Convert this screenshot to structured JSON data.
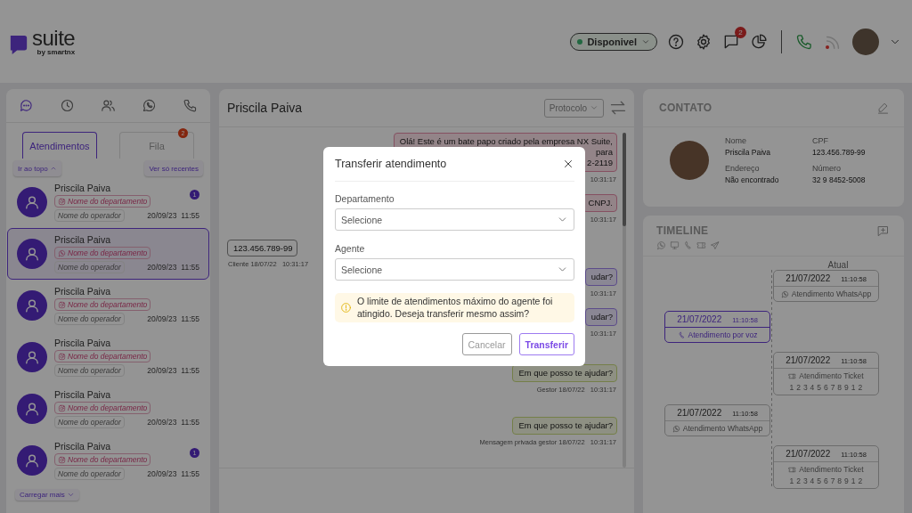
{
  "header": {
    "brand": "suite",
    "brand_sub": "by smartnx",
    "status": {
      "label": "Disponivel"
    },
    "notification_count": "2"
  },
  "left_panel": {
    "channel_tabs": [
      {
        "kind": "chat",
        "selected": true
      },
      {
        "kind": "history",
        "selected": false
      },
      {
        "kind": "contacts",
        "selected": false
      },
      {
        "kind": "whatsapp",
        "selected": false
      },
      {
        "kind": "phone",
        "selected": false
      }
    ],
    "list_tabs": [
      {
        "label": "Atendimentos",
        "selected": true
      },
      {
        "label": "Fila",
        "selected": false,
        "badge": "2"
      }
    ],
    "scroll_top": "Ir ao topo",
    "recent_only": "Ver só recentes",
    "conversations": [
      {
        "name": "Priscila Paiva",
        "kind": "instagram",
        "department": "Nome do departamento",
        "operator": "Nome do operador",
        "date": "20/09/23",
        "time": "11:55",
        "unread": "1",
        "selected": false
      },
      {
        "name": "Priscila Paiva",
        "kind": "whatsapp",
        "department": "Nome do departamento",
        "operator": "Nome do operador",
        "date": "20/09/23",
        "time": "11:55",
        "selected": true
      },
      {
        "name": "Priscila Paiva",
        "kind": "instagram",
        "department": "Nome do departamento",
        "operator": "Nome do operador",
        "date": "20/09/23",
        "time": "11:55",
        "selected": false
      },
      {
        "name": "Priscila Paiva",
        "kind": "instagram",
        "department": "Nome do departamento",
        "operator": "Nome do operador",
        "date": "20/09/23",
        "time": "11:55",
        "selected": false
      },
      {
        "name": "Priscila Paiva",
        "kind": "instagram",
        "department": "Nome do departamento",
        "operator": "Nome do operador",
        "date": "20/09/23",
        "time": "11:55",
        "selected": false
      },
      {
        "name": "Priscila Paiva",
        "kind": "instagram",
        "department": "Nome do departamento",
        "operator": "Nome do operador",
        "date": "20/09/23",
        "time": "11:55",
        "unread": "1",
        "selected": false
      }
    ],
    "load_more": "Carregar mais"
  },
  "chat": {
    "title": "Priscila Paiva",
    "protocol_label": "Protocolo",
    "messages": [
      {
        "kind": "bot",
        "lines": [
          "Olá! Este é um bate papo criado pela empresa NX Suite,",
          "para",
          "2-2119"
        ],
        "meta": "10:31:17"
      },
      {
        "kind": "bot",
        "lines": [
          "CNPJ."
        ],
        "meta": "10:31:17"
      },
      {
        "kind": "client",
        "lines": [
          "123.456.789-99"
        ],
        "meta": "Cliente 18/07/22   10:31:17"
      },
      {
        "kind": "agent",
        "lines": [
          "udar?"
        ],
        "meta": "10:31:17"
      },
      {
        "kind": "agent",
        "lines": [
          "udar?"
        ],
        "meta": "10:31:17"
      },
      {
        "kind": "manager",
        "lines": [
          "Em que posso te ajudar?"
        ],
        "meta": "Gestor 18/07/22   10:31:17"
      },
      {
        "kind": "manager",
        "lines": [
          "Em que posso te ajudar?"
        ],
        "meta": "Mensagem privada gestor 18/07/22   10:31:17"
      }
    ]
  },
  "contact": {
    "title": "CONTATO",
    "fields": [
      {
        "label": "Nome",
        "value": "Priscila Paiva"
      },
      {
        "label": "CPF",
        "value": "123.456.789-99"
      },
      {
        "label": "Endereço",
        "value": "Não encontrado"
      },
      {
        "label": "Número",
        "value": "32 9 8452-5008"
      }
    ]
  },
  "timeline": {
    "title": "TIMELINE",
    "filters": [
      {
        "kind": "whatsapp"
      },
      {
        "kind": "monitor"
      },
      {
        "kind": "voice"
      },
      {
        "kind": "ticket"
      },
      {
        "kind": "telegram"
      }
    ],
    "current_label": "Atual",
    "events": [
      {
        "right": {
          "date": "21/07/2022",
          "time": "11:10:58",
          "kind": "whatsapp",
          "label": "Atendimento WhatsApp",
          "selected": false
        }
      },
      {
        "left": {
          "date": "21/07/2022",
          "time": "11:10:58",
          "kind": "voice",
          "label": "Atendimento por voz",
          "selected": true
        }
      },
      {
        "right": {
          "date": "21/07/2022",
          "time": "11:10:58",
          "kind": "ticket",
          "label": "Atendimento Ticket",
          "number": "1 2 3 4 5 6 7 8 9 1 2",
          "selected": false
        }
      },
      {
        "left": {
          "date": "21/07/2022",
          "time": "11:10:58",
          "kind": "whatsapp",
          "label": "Atendimento WhatsApp",
          "selected": false
        }
      },
      {
        "right": {
          "date": "21/07/2022",
          "time": "11:10:58",
          "kind": "ticket",
          "label": "Atendimento Ticket",
          "number": "1 2 3 4 5 6 7 8 9 1 2",
          "selected": false
        }
      }
    ]
  },
  "modal": {
    "title": "Transferir atendimento",
    "fields": [
      {
        "label": "Departamento",
        "placeholder": "Selecione"
      },
      {
        "label": "Agente",
        "placeholder": "Selecione"
      }
    ],
    "warning": "O limite de atendimentos máximo do agente foi atingido. Deseja transferir mesmo assim?",
    "buttons": [
      {
        "label": "Cancelar",
        "kind": "secondary"
      },
      {
        "label": "Transferir",
        "kind": "primary"
      }
    ]
  }
}
